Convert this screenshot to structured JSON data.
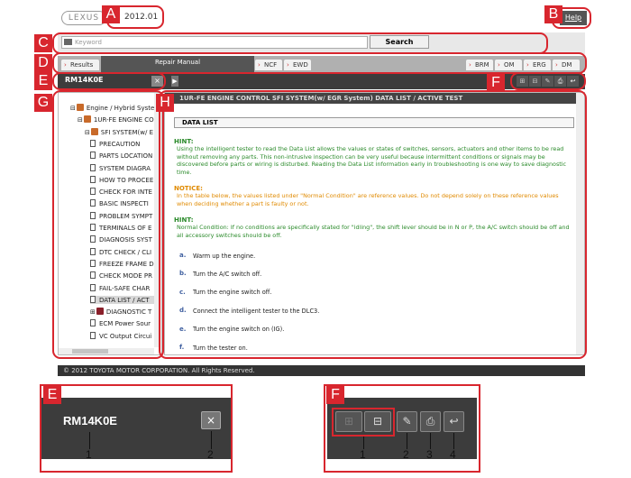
{
  "header": {
    "logo": "LEXUS",
    "version": "2012.01",
    "help_label": "Help"
  },
  "search": {
    "placeholder": "Keyword",
    "button_label": "Search"
  },
  "tabs": {
    "results": "Results",
    "repair_manual": "Repair Manual",
    "ncf": "NCF",
    "ewd": "EWD",
    "brm": "BRM",
    "om": "OM",
    "erg": "ERG",
    "dm": "DM"
  },
  "doc_bar": {
    "title": "RM14K0E",
    "close_glyph": "×",
    "arrow_glyph": "▶"
  },
  "tree": {
    "items": [
      {
        "label": "Engine / Hybrid Syste",
        "level": 0,
        "kind": "book"
      },
      {
        "label": "1UR-FE ENGINE CO",
        "level": 1,
        "kind": "book"
      },
      {
        "label": "SFI SYSTEM(w/ E",
        "level": 2,
        "kind": "book"
      },
      {
        "label": "PRECAUTION",
        "level": 3,
        "kind": "doc"
      },
      {
        "label": "PARTS LOCATION",
        "level": 3,
        "kind": "doc"
      },
      {
        "label": "SYSTEM DIAGRA",
        "level": 3,
        "kind": "doc"
      },
      {
        "label": "HOW TO PROCEE",
        "level": 3,
        "kind": "doc"
      },
      {
        "label": "CHECK FOR INTE",
        "level": 3,
        "kind": "doc"
      },
      {
        "label": "BASIC INSPECTI",
        "level": 3,
        "kind": "doc"
      },
      {
        "label": "PROBLEM SYMPT",
        "level": 3,
        "kind": "doc"
      },
      {
        "label": "TERMINALS OF E",
        "level": 3,
        "kind": "doc"
      },
      {
        "label": "DIAGNOSIS SYST",
        "level": 3,
        "kind": "doc"
      },
      {
        "label": "DTC CHECK / CLI",
        "level": 3,
        "kind": "doc"
      },
      {
        "label": "FREEZE FRAME D",
        "level": 3,
        "kind": "doc"
      },
      {
        "label": "CHECK MODE PR",
        "level": 3,
        "kind": "doc"
      },
      {
        "label": "FAIL-SAFE CHAR",
        "level": 3,
        "kind": "doc"
      },
      {
        "label": "DATA LIST / ACT",
        "level": 3,
        "kind": "doc",
        "selected": true
      },
      {
        "label": "DIAGNOSTIC T",
        "level": 3,
        "kind": "diag"
      },
      {
        "label": "ECM Power Sour",
        "level": 3,
        "kind": "doc"
      },
      {
        "label": "VC Output Circui",
        "level": 3,
        "kind": "doc"
      }
    ]
  },
  "content": {
    "title": "1UR-FE ENGINE CONTROL  SFI SYSTEM(w/ EGR System)  DATA LIST / ACTIVE TEST",
    "section": "DATA LIST",
    "hint1_label": "HINT:",
    "hint1_text": "Using the intelligent tester to read the Data List allows the values or states of switches, sensors, actuators and other items to be read without removing any parts. This non-intrusive inspection can be very useful because intermittent conditions or signals may be discovered before parts or wiring is disturbed. Reading the Data List information early in troubleshooting is one way to save diagnostic time.",
    "notice_label": "NOTICE:",
    "notice_text": "In the table below, the values listed under \"Normal Condition\" are reference values. Do not depend solely on these reference values when deciding whether a part is faulty or not.",
    "hint2_label": "HINT:",
    "hint2_text": "Normal Condition: If no conditions are specifically stated for \"idling\", the shift lever should be in N or P, the A/C switch should be off and all accessory switches should be off.",
    "steps": [
      {
        "letter": "a.",
        "text": "Warm up the engine."
      },
      {
        "letter": "b.",
        "text": "Turn the A/C switch off."
      },
      {
        "letter": "c.",
        "text": "Turn the engine switch off."
      },
      {
        "letter": "d.",
        "text": "Connect the intelligent tester to the DLC3."
      },
      {
        "letter": "e.",
        "text": "Turn the engine switch on (IG)."
      },
      {
        "letter": "f.",
        "text": "Turn the tester on."
      }
    ]
  },
  "footer": {
    "copyright": "© 2012 TOYOTA MOTOR CORPORATION. All Rights Reserved."
  },
  "callouts": {
    "A": "A",
    "B": "B",
    "C": "C",
    "D": "D",
    "E": "E",
    "F": "F",
    "G": "G",
    "H": "H"
  },
  "detail_e": {
    "label": "E",
    "title": "RM14K0E",
    "close_glyph": "×",
    "num1": "1",
    "num2": "2"
  },
  "detail_f": {
    "label": "F",
    "num1": "1",
    "num2": "2",
    "num3": "3",
    "num4": "4"
  },
  "colors": {
    "annotation_red": "#d8262e",
    "hint_green": "#2a8a2a",
    "notice_orange": "#e08a00",
    "toolbar_dark": "#3c3c3c"
  }
}
